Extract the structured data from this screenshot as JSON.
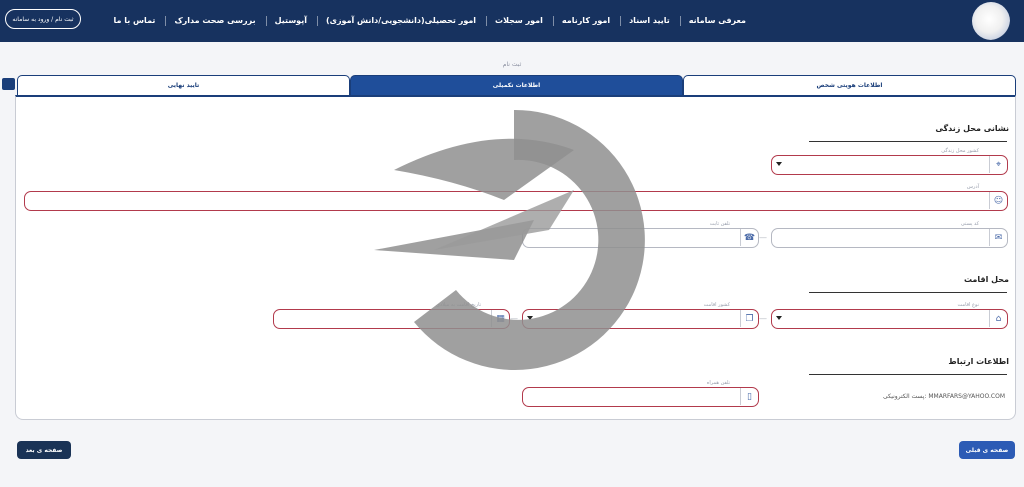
{
  "header": {
    "nav": [
      "معرفی سامانه",
      "تایید اسناد",
      "امور کارنامه",
      "امور سجلات",
      "امور تحصیلی(دانشجویی/دانش آموزی)",
      "آپوستیل",
      "بررسی صحت مدارک",
      "تماس با ما"
    ],
    "login_label": "ثبت نام / ورود به سامانه"
  },
  "page_title": "ثبت نام",
  "tabs": {
    "personal": "اطلاعات هویتی شخص",
    "extra": "اطلاعات تکمیلی",
    "final": "تایید نهایی"
  },
  "sections": {
    "residence_address": "نشانی محل زندگی",
    "residence_place": "محل اقامت",
    "contact": "اطلاعات ارتباط"
  },
  "fields": {
    "country": "کشور محل زندگی",
    "address": "آدرس",
    "postal_code": "کد پستی",
    "phone": "تلفن ثابت",
    "residence_type": "نوع اقامت",
    "residence_country": "کشور اقامت",
    "residence_date": "تاریخ اقامت به میلادی",
    "mobile": "تلفن همراه"
  },
  "email_label": "پست الکترونیکی",
  "email_value": "MMARFARS@YAHOO.COM",
  "buttons": {
    "prev": "صفحه ی قبلی",
    "next": "صفحه ی بعد"
  }
}
